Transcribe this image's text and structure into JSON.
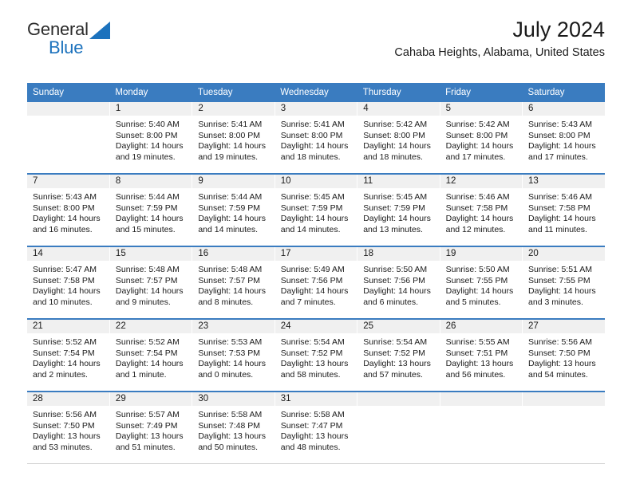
{
  "brand": {
    "line1": "General",
    "line2": "Blue",
    "accent_color": "#1c72bd"
  },
  "header": {
    "title": "July 2024",
    "subtitle": "Cahaba Heights, Alabama, United States"
  },
  "calendar": {
    "header_color": "#3a7cc0",
    "daynum_bg": "#f0f0f0",
    "weekday_labels": [
      "Sunday",
      "Monday",
      "Tuesday",
      "Wednesday",
      "Thursday",
      "Friday",
      "Saturday"
    ],
    "weeks": [
      [
        {
          "day": "",
          "empty": true
        },
        {
          "day": "1",
          "sunrise": "Sunrise: 5:40 AM",
          "sunset": "Sunset: 8:00 PM",
          "daylight": "Daylight: 14 hours and 19 minutes."
        },
        {
          "day": "2",
          "sunrise": "Sunrise: 5:41 AM",
          "sunset": "Sunset: 8:00 PM",
          "daylight": "Daylight: 14 hours and 19 minutes."
        },
        {
          "day": "3",
          "sunrise": "Sunrise: 5:41 AM",
          "sunset": "Sunset: 8:00 PM",
          "daylight": "Daylight: 14 hours and 18 minutes."
        },
        {
          "day": "4",
          "sunrise": "Sunrise: 5:42 AM",
          "sunset": "Sunset: 8:00 PM",
          "daylight": "Daylight: 14 hours and 18 minutes."
        },
        {
          "day": "5",
          "sunrise": "Sunrise: 5:42 AM",
          "sunset": "Sunset: 8:00 PM",
          "daylight": "Daylight: 14 hours and 17 minutes."
        },
        {
          "day": "6",
          "sunrise": "Sunrise: 5:43 AM",
          "sunset": "Sunset: 8:00 PM",
          "daylight": "Daylight: 14 hours and 17 minutes."
        }
      ],
      [
        {
          "day": "7",
          "sunrise": "Sunrise: 5:43 AM",
          "sunset": "Sunset: 8:00 PM",
          "daylight": "Daylight: 14 hours and 16 minutes."
        },
        {
          "day": "8",
          "sunrise": "Sunrise: 5:44 AM",
          "sunset": "Sunset: 7:59 PM",
          "daylight": "Daylight: 14 hours and 15 minutes."
        },
        {
          "day": "9",
          "sunrise": "Sunrise: 5:44 AM",
          "sunset": "Sunset: 7:59 PM",
          "daylight": "Daylight: 14 hours and 14 minutes."
        },
        {
          "day": "10",
          "sunrise": "Sunrise: 5:45 AM",
          "sunset": "Sunset: 7:59 PM",
          "daylight": "Daylight: 14 hours and 14 minutes."
        },
        {
          "day": "11",
          "sunrise": "Sunrise: 5:45 AM",
          "sunset": "Sunset: 7:59 PM",
          "daylight": "Daylight: 14 hours and 13 minutes."
        },
        {
          "day": "12",
          "sunrise": "Sunrise: 5:46 AM",
          "sunset": "Sunset: 7:58 PM",
          "daylight": "Daylight: 14 hours and 12 minutes."
        },
        {
          "day": "13",
          "sunrise": "Sunrise: 5:46 AM",
          "sunset": "Sunset: 7:58 PM",
          "daylight": "Daylight: 14 hours and 11 minutes."
        }
      ],
      [
        {
          "day": "14",
          "sunrise": "Sunrise: 5:47 AM",
          "sunset": "Sunset: 7:58 PM",
          "daylight": "Daylight: 14 hours and 10 minutes."
        },
        {
          "day": "15",
          "sunrise": "Sunrise: 5:48 AM",
          "sunset": "Sunset: 7:57 PM",
          "daylight": "Daylight: 14 hours and 9 minutes."
        },
        {
          "day": "16",
          "sunrise": "Sunrise: 5:48 AM",
          "sunset": "Sunset: 7:57 PM",
          "daylight": "Daylight: 14 hours and 8 minutes."
        },
        {
          "day": "17",
          "sunrise": "Sunrise: 5:49 AM",
          "sunset": "Sunset: 7:56 PM",
          "daylight": "Daylight: 14 hours and 7 minutes."
        },
        {
          "day": "18",
          "sunrise": "Sunrise: 5:50 AM",
          "sunset": "Sunset: 7:56 PM",
          "daylight": "Daylight: 14 hours and 6 minutes."
        },
        {
          "day": "19",
          "sunrise": "Sunrise: 5:50 AM",
          "sunset": "Sunset: 7:55 PM",
          "daylight": "Daylight: 14 hours and 5 minutes."
        },
        {
          "day": "20",
          "sunrise": "Sunrise: 5:51 AM",
          "sunset": "Sunset: 7:55 PM",
          "daylight": "Daylight: 14 hours and 3 minutes."
        }
      ],
      [
        {
          "day": "21",
          "sunrise": "Sunrise: 5:52 AM",
          "sunset": "Sunset: 7:54 PM",
          "daylight": "Daylight: 14 hours and 2 minutes."
        },
        {
          "day": "22",
          "sunrise": "Sunrise: 5:52 AM",
          "sunset": "Sunset: 7:54 PM",
          "daylight": "Daylight: 14 hours and 1 minute."
        },
        {
          "day": "23",
          "sunrise": "Sunrise: 5:53 AM",
          "sunset": "Sunset: 7:53 PM",
          "daylight": "Daylight: 14 hours and 0 minutes."
        },
        {
          "day": "24",
          "sunrise": "Sunrise: 5:54 AM",
          "sunset": "Sunset: 7:52 PM",
          "daylight": "Daylight: 13 hours and 58 minutes."
        },
        {
          "day": "25",
          "sunrise": "Sunrise: 5:54 AM",
          "sunset": "Sunset: 7:52 PM",
          "daylight": "Daylight: 13 hours and 57 minutes."
        },
        {
          "day": "26",
          "sunrise": "Sunrise: 5:55 AM",
          "sunset": "Sunset: 7:51 PM",
          "daylight": "Daylight: 13 hours and 56 minutes."
        },
        {
          "day": "27",
          "sunrise": "Sunrise: 5:56 AM",
          "sunset": "Sunset: 7:50 PM",
          "daylight": "Daylight: 13 hours and 54 minutes."
        }
      ],
      [
        {
          "day": "28",
          "sunrise": "Sunrise: 5:56 AM",
          "sunset": "Sunset: 7:50 PM",
          "daylight": "Daylight: 13 hours and 53 minutes."
        },
        {
          "day": "29",
          "sunrise": "Sunrise: 5:57 AM",
          "sunset": "Sunset: 7:49 PM",
          "daylight": "Daylight: 13 hours and 51 minutes."
        },
        {
          "day": "30",
          "sunrise": "Sunrise: 5:58 AM",
          "sunset": "Sunset: 7:48 PM",
          "daylight": "Daylight: 13 hours and 50 minutes."
        },
        {
          "day": "31",
          "sunrise": "Sunrise: 5:58 AM",
          "sunset": "Sunset: 7:47 PM",
          "daylight": "Daylight: 13 hours and 48 minutes."
        },
        {
          "day": "",
          "empty": true
        },
        {
          "day": "",
          "empty": true
        },
        {
          "day": "",
          "empty": true
        }
      ]
    ]
  }
}
